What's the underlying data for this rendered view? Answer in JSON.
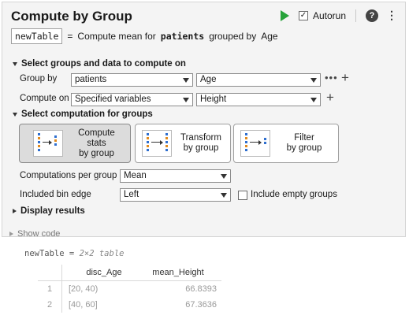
{
  "title": "Compute by Group",
  "toolbar": {
    "autorun_label": "Autorun",
    "autorun_checked": true
  },
  "summary": {
    "output_var": "newTable",
    "equals": "=",
    "prefix": "Compute mean for",
    "data_var": "patients",
    "middle": "grouped by",
    "group_var": "Age"
  },
  "section_groups": {
    "label": "Select groups and data to compute on"
  },
  "group_by": {
    "label": "Group by",
    "table_value": "patients",
    "var_value": "Age"
  },
  "compute_on": {
    "label": "Compute on",
    "mode_value": "Specified variables",
    "var_value": "Height"
  },
  "section_computation": {
    "label": "Select computation for groups"
  },
  "computation_buttons": [
    {
      "line1": "Compute",
      "line2": "stats",
      "line3": "by group",
      "selected": true
    },
    {
      "line1": "Transform",
      "line2": "by group",
      "selected": false
    },
    {
      "line1": "Filter",
      "line2": "by group",
      "selected": false
    }
  ],
  "computations_per_group": {
    "label": "Computations per group",
    "value": "Mean"
  },
  "included_bin_edge": {
    "label": "Included bin edge",
    "value": "Left"
  },
  "include_empty": {
    "label": "Include empty groups",
    "checked": false
  },
  "section_display": {
    "label": "Display results"
  },
  "show_code": {
    "label": "Show code"
  },
  "output": {
    "var_name": "newTable",
    "equals": "=",
    "size_text": "2×2 table",
    "columns": [
      "disc_Age",
      "mean_Height"
    ],
    "rows": [
      {
        "index": "1",
        "disc_Age": "[20, 40)",
        "mean_Height": "66.8393"
      },
      {
        "index": "2",
        "disc_Age": "[40, 60]",
        "mean_Height": "67.3636"
      }
    ]
  },
  "colors": {
    "run": "#27a33a",
    "panel": "#f4f4f4",
    "selected_button": "#dcdcdc"
  }
}
